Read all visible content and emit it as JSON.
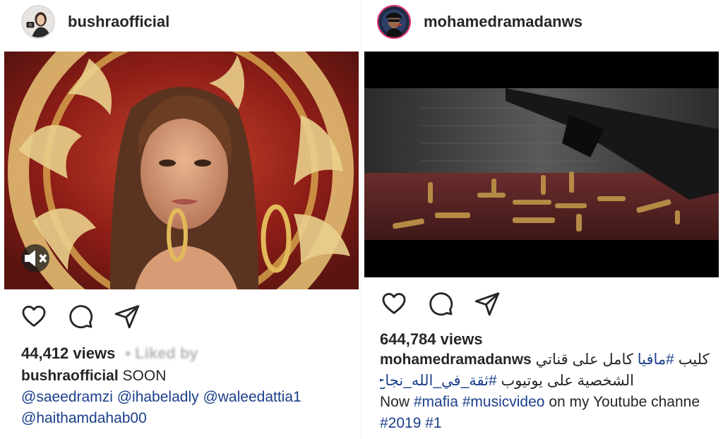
{
  "accent": {
    "link": "#1b3f8b",
    "story_ring": "#e1306c"
  },
  "left_post": {
    "username": "bushraofficial",
    "avatar_icon": "profile-photo-icon",
    "views": "44,412 views",
    "liked_by": "• Liked by",
    "caption_user": "bushraofficial",
    "caption_text": "SOON",
    "mentions": [
      "@saeedramzi",
      "@ihabeladly",
      "@waleedattia1",
      "@haithamdahab00"
    ]
  },
  "right_post": {
    "username": "mohamedramadanws",
    "avatar_icon": "profile-photo-icon",
    "views": "644,784 views",
    "caption_user": "mohamedramadanws",
    "caption_ar_1a": "كليب",
    "caption_ar_1b": "#مافيا",
    "caption_ar_1c": "كامل على قناتي",
    "caption_ar_2a": "الشخصية على يوتيوب",
    "caption_ar_2b": "#ثقة_في_الله_نجاح",
    "caption_en_1": "Now",
    "hashtag_mafia": "#mafia",
    "hashtag_musicvideo": "#musicvideo",
    "caption_en_2": "on my Youtube channe",
    "hashtag_2019": "#2019",
    "hashtag_1": "#1"
  },
  "icons": {
    "like": "heart-icon",
    "comment": "comment-bubble-icon",
    "share": "paper-plane-icon",
    "mute": "speaker-muted-icon"
  }
}
